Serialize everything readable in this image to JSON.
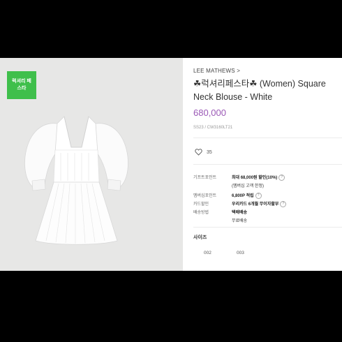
{
  "badge": {
    "label": "럭셔리 페스타"
  },
  "product": {
    "brand": "LEE MATHEWS >",
    "title_line1": "☘럭셔리페스타☘  (Women) Square",
    "title_line2": "Neck Blouse - White",
    "price": "680,000",
    "code": "SS23 / CW3160LT21",
    "likes": "35"
  },
  "details": [
    {
      "label": "기프트포인트",
      "value": "최대 68,000원 할인(10%)",
      "note": "(멤버십 고객 한정)"
    },
    {
      "label": "멤버십포인트",
      "value": "6,800P 적립"
    },
    {
      "label": "카드할인",
      "value": "우리카드 6개월 무이자할부"
    },
    {
      "label": "배송방법",
      "value": "택배배송",
      "note": "무료배송"
    }
  ],
  "size": {
    "title": "사이즈",
    "options": [
      "002",
      "003"
    ]
  },
  "colors": {
    "price": "#9b59b6",
    "badge": "#3fbf4b"
  },
  "icons": {
    "like": "heart-icon",
    "info": "question-circle-icon"
  }
}
